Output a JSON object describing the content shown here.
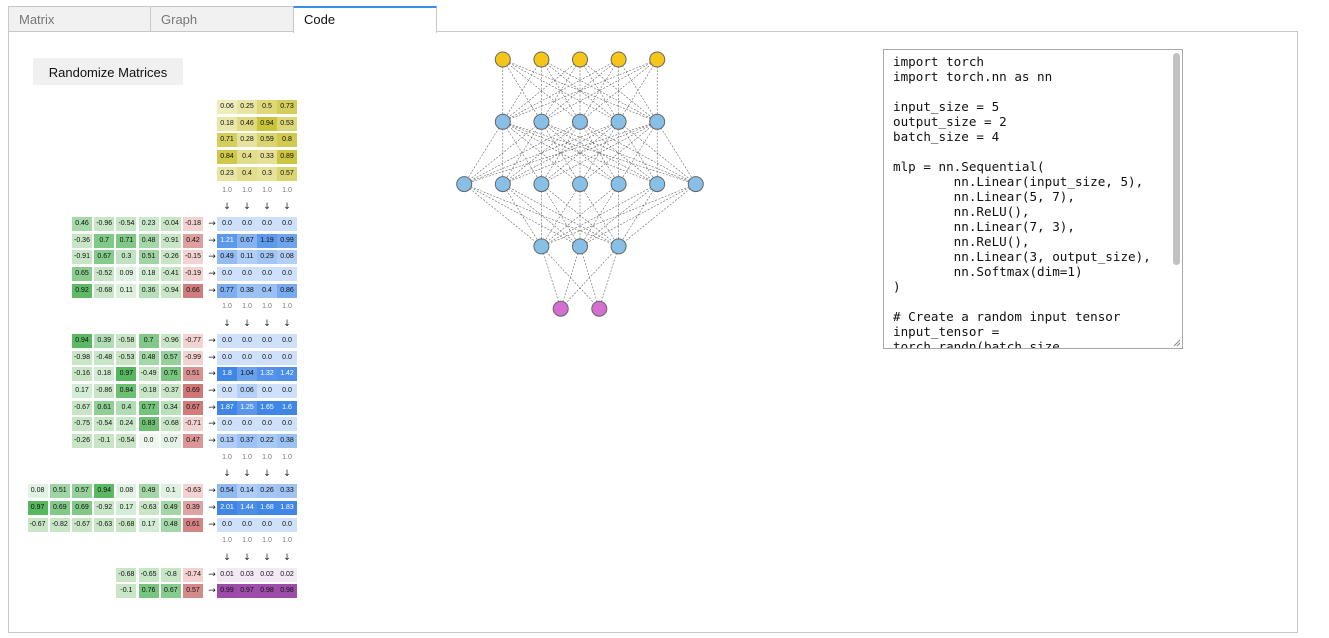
{
  "tabs": [
    {
      "label": "Matrix",
      "active": false
    },
    {
      "label": "Graph",
      "active": false
    },
    {
      "label": "Code",
      "active": true
    }
  ],
  "randomize_button": "Randomize Matrices",
  "matrix_view": {
    "ones_label": "1.0",
    "down_arrow": "↓",
    "right_arrow": "→",
    "input": [
      [
        "0.06",
        "0.25",
        "0.5",
        "0.73"
      ],
      [
        "0.18",
        "0.46",
        "0.94",
        "0.53"
      ],
      [
        "0.71",
        "0.28",
        "0.59",
        "0.8"
      ],
      [
        "0.84",
        "0.4",
        "0.33",
        "0.89"
      ],
      [
        "0.23",
        "0.4",
        "0.3",
        "0.57"
      ]
    ],
    "layers": [
      {
        "weights": [
          [
            "0.46",
            "-0.96",
            "-0.54",
            "0.23",
            "-0.04"
          ],
          [
            "-0.36",
            "0.7",
            "0.71",
            "0.48",
            "-0.91"
          ],
          [
            "-0.91",
            "0.67",
            "0.3",
            "0.51",
            "-0.26"
          ],
          [
            "0.65",
            "-0.52",
            "0.09",
            "0.18",
            "-0.41"
          ],
          [
            "0.92",
            "-0.68",
            "0.11",
            "0.36",
            "-0.94"
          ]
        ],
        "bias": [
          "-0.18",
          "0.42",
          "-0.15",
          "-0.19",
          "0.66"
        ],
        "output": [
          [
            "0.0",
            "0.0",
            "0.0",
            "0.0"
          ],
          [
            "1.21",
            "0.67",
            "1.19",
            "0.99"
          ],
          [
            "0.49",
            "0.11",
            "0.29",
            "0.08"
          ],
          [
            "0.0",
            "0.0",
            "0.0",
            "0.0"
          ],
          [
            "0.77",
            "0.38",
            "0.4",
            "0.86"
          ]
        ],
        "output_kind": "hidden"
      },
      {
        "weights": [
          [
            "0.94",
            "0.39",
            "-0.58",
            "0.7",
            "-0.96"
          ],
          [
            "-0.98",
            "-0.48",
            "-0.53",
            "0.48",
            "0.57"
          ],
          [
            "-0.16",
            "0.18",
            "0.97",
            "-0.49",
            "0.76"
          ],
          [
            "0.17",
            "-0.86",
            "0.84",
            "-0.18",
            "-0.37"
          ],
          [
            "-0.67",
            "0.61",
            "0.4",
            "0.77",
            "0.34"
          ],
          [
            "-0.75",
            "-0.54",
            "0.24",
            "0.83",
            "-0.68"
          ],
          [
            "-0.26",
            "-0.1",
            "-0.54",
            "0.0",
            "0.07"
          ]
        ],
        "bias": [
          "-0.77",
          "-0.99",
          "0.51",
          "0.69",
          "0.67",
          "-0.71",
          "0.47"
        ],
        "output": [
          [
            "0.0",
            "0.0",
            "0.0",
            "0.0"
          ],
          [
            "0.0",
            "0.0",
            "0.0",
            "0.0"
          ],
          [
            "1.8",
            "1.04",
            "1.32",
            "1.42"
          ],
          [
            "0.0",
            "0.06",
            "0.0",
            "0.0"
          ],
          [
            "1.87",
            "1.25",
            "1.65",
            "1.6"
          ],
          [
            "0.0",
            "0.0",
            "0.0",
            "0.0"
          ],
          [
            "0.13",
            "0.37",
            "0.22",
            "0.38"
          ]
        ],
        "output_kind": "hidden"
      },
      {
        "weights": [
          [
            "0.08",
            "0.51",
            "0.57",
            "0.94",
            "0.08",
            "0.49",
            "0.1"
          ],
          [
            "0.97",
            "0.69",
            "0.69",
            "-0.92",
            "0.17",
            "-0.63",
            "0.49"
          ],
          [
            "-0.67",
            "-0.82",
            "-0.67",
            "-0.63",
            "-0.68",
            "0.17",
            "0.48"
          ]
        ],
        "bias": [
          "-0.63",
          "0.39",
          "0.61"
        ],
        "output": [
          [
            "0.54",
            "0.14",
            "0.26",
            "0.33"
          ],
          [
            "2.01",
            "1.44",
            "1.68",
            "1.83"
          ],
          [
            "0.0",
            "0.0",
            "0.0",
            "0.0"
          ]
        ],
        "output_kind": "hidden"
      },
      {
        "weights": [
          [
            "-0.68",
            "-0.65",
            "-0.8"
          ],
          [
            "-0.1",
            "0.76",
            "0.67"
          ]
        ],
        "bias": [
          "-0.74",
          "0.57"
        ],
        "output": [
          [
            "0.01",
            "0.03",
            "0.02",
            "0.02"
          ],
          [
            "0.99",
            "0.97",
            "0.98",
            "0.98"
          ]
        ],
        "output_kind": "softmax"
      }
    ]
  },
  "graph": {
    "layer_sizes": [
      5,
      5,
      7,
      3,
      2
    ],
    "colors": {
      "input": "#f5c518",
      "hidden": "#87bfe6",
      "output": "#d26fd0",
      "edge": "#666666",
      "stroke": "#666666"
    }
  },
  "colors": {
    "weight_pos": "#52b55a",
    "weight_neg": "#c8e6c6",
    "bias_pos": "#c86464",
    "bias_neg": "#f3d2d2",
    "input": "#c8c030",
    "hidden": "#3f86e6",
    "softmax": "#9c4aa8",
    "tab_accent": "#3b8ee8"
  },
  "code": {
    "text": "import torch\nimport torch.nn as nn\n\ninput_size = 5\noutput_size = 2\nbatch_size = 4\n\nmlp = nn.Sequential(\n        nn.Linear(input_size, 5),\n        nn.Linear(5, 7),\n        nn.ReLU(),\n        nn.Linear(7, 3),\n        nn.ReLU(),\n        nn.Linear(3, output_size),\n        nn.Softmax(dim=1)\n)\n\n# Create a random input tensor\ninput_tensor =\ntorch.randn(batch_size"
  }
}
